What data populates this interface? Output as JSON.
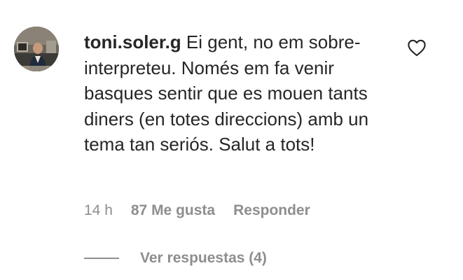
{
  "comment": {
    "username": "toni.soler.g",
    "text": "Ei gent, no em sobre-interpreteu. Només em fa venir basques sentir que es mouen tants diners (en totes direccions) amb un tema tan seriós. Salut a tots!",
    "time": "14 h",
    "likes": "87 Me gusta",
    "reply_label": "Responder",
    "view_replies": "Ver respuestas (4)",
    "like_icon": "heart-outline-icon"
  },
  "colors": {
    "text": "#262626",
    "secondary": "#8e8e8e",
    "background": "#ffffff"
  }
}
